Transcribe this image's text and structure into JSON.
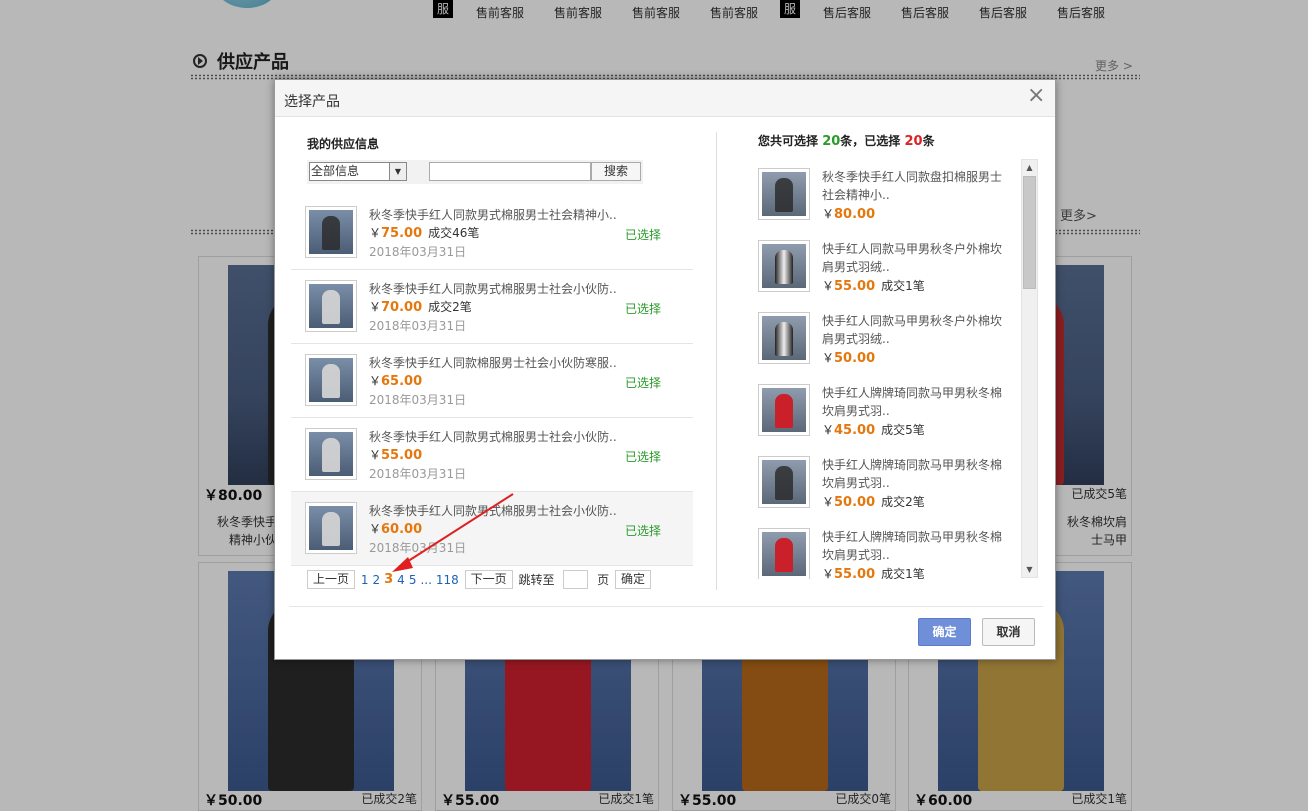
{
  "background": {
    "nav_tags": [
      "服",
      "服"
    ],
    "nav_items": [
      "售前客服",
      "售前客服",
      "售前客服",
      "售前客服",
      "售后客服",
      "售后客服",
      "售后客服",
      "售后客服"
    ],
    "section_title": "供应产品",
    "more_top": "更多 >",
    "more_mid": "更多>",
    "cards_row1": [
      {
        "price": "￥80.00",
        "sold": "",
        "desc": "秋冬季快手红\n精神小伙"
      },
      {
        "price": "",
        "sold": "已成交5笔",
        "desc": "秋冬棉坎肩\n士马甲"
      }
    ],
    "cards_row2": [
      {
        "price": "￥50.00",
        "sold": "已成交2笔"
      },
      {
        "price": "￥55.00",
        "sold": "已成交1笔"
      },
      {
        "price": "￥55.00",
        "sold": "已成交0笔"
      },
      {
        "price": "￥60.00",
        "sold": "已成交1笔"
      }
    ]
  },
  "modal": {
    "title": "选择产品",
    "close_icon": "close-icon",
    "left": {
      "heading": "我的供应信息",
      "filter_selected": "全部信息",
      "search_placeholder": "",
      "search_button": "搜索",
      "products": [
        {
          "name": "秋冬季快手红人同款男式棉服男士社会精神小..",
          "price": "75.00",
          "deals": "成交46笔",
          "date": "2018年03月31日",
          "status": "已选择",
          "tone": "dark"
        },
        {
          "name": "秋冬季快手红人同款男式棉服男士社会小伙防..",
          "price": "70.00",
          "deals": "成交2笔",
          "date": "2018年03月31日",
          "status": "已选择",
          "tone": "light"
        },
        {
          "name": "秋冬季快手红人同款棉服男士社会小伙防寒服..",
          "price": "65.00",
          "deals": "",
          "date": "2018年03月31日",
          "status": "已选择",
          "tone": "light"
        },
        {
          "name": "秋冬季快手红人同款男式棉服男士社会小伙防..",
          "price": "55.00",
          "deals": "",
          "date": "2018年03月31日",
          "status": "已选择",
          "tone": "light"
        },
        {
          "name": "秋冬季快手红人同款男式棉服男士社会小伙防..",
          "price": "60.00",
          "deals": "",
          "date": "2018年03月31日",
          "status": "已选择",
          "tone": "light"
        }
      ],
      "currency": "￥",
      "pager": {
        "prev": "上一页",
        "pages": [
          "1",
          "2",
          "3",
          "4",
          "5",
          "...",
          "118"
        ],
        "current": "3",
        "next": "下一页",
        "jump_label": "跳转至",
        "page_label": "页",
        "confirm": "确定"
      }
    },
    "right": {
      "count_prefix": "您共可选择 ",
      "total": "20",
      "count_mid": "条，已选择 ",
      "selected": "20",
      "count_suffix": "条",
      "items": [
        {
          "name": "秋冬季快手红人同款盘扣棉服男士社会精神小..",
          "price": "80.00",
          "deals": "",
          "tone": "dark"
        },
        {
          "name": "快手红人同款马甲男秋冬户外棉坎肩男式羽绒..",
          "price": "55.00",
          "deals": "成交1笔",
          "tone": "stripe"
        },
        {
          "name": "快手红人同款马甲男秋冬户外棉坎肩男式羽绒..",
          "price": "50.00",
          "deals": "",
          "tone": "stripe"
        },
        {
          "name": "快手红人牌牌琦同款马甲男秋冬棉坎肩男式羽..",
          "price": "45.00",
          "deals": "成交5笔",
          "tone": "red"
        },
        {
          "name": "快手红人牌牌琦同款马甲男秋冬棉坎肩男式羽..",
          "price": "50.00",
          "deals": "成交2笔",
          "tone": "dark"
        },
        {
          "name": "快手红人牌牌琦同款马甲男秋冬棉坎肩男式羽..",
          "price": "55.00",
          "deals": "成交1笔",
          "tone": "red"
        }
      ]
    },
    "ok_button": "确定",
    "cancel_button": "取消"
  },
  "colors": {
    "accent_price": "#e4770d",
    "selected_green": "#2a9a2a",
    "ok_blue": "#6f90d8",
    "count_red": "#d22222",
    "arrow_red": "#e02020"
  }
}
